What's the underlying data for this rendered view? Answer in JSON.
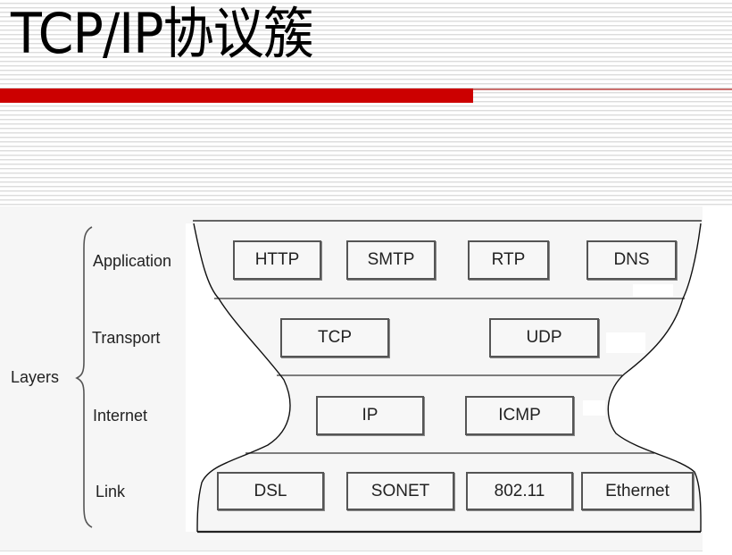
{
  "slide": {
    "title_latin": "TCP/IP",
    "title_cjk": "协议簇"
  },
  "diagram": {
    "group_label": "Layers",
    "layers": [
      {
        "name": "Application",
        "protocols": [
          "HTTP",
          "SMTP",
          "RTP",
          "DNS"
        ]
      },
      {
        "name": "Transport",
        "protocols": [
          "TCP",
          "UDP"
        ]
      },
      {
        "name": "Internet",
        "protocols": [
          "IP",
          "ICMP"
        ]
      },
      {
        "name": "Link",
        "protocols": [
          "DSL",
          "SONET",
          "802.11",
          "Ethernet"
        ]
      }
    ]
  },
  "colors": {
    "accent_red": "#cc0000",
    "stripe_gray": "#dcdcdc",
    "panel_gray": "#f6f6f6"
  }
}
